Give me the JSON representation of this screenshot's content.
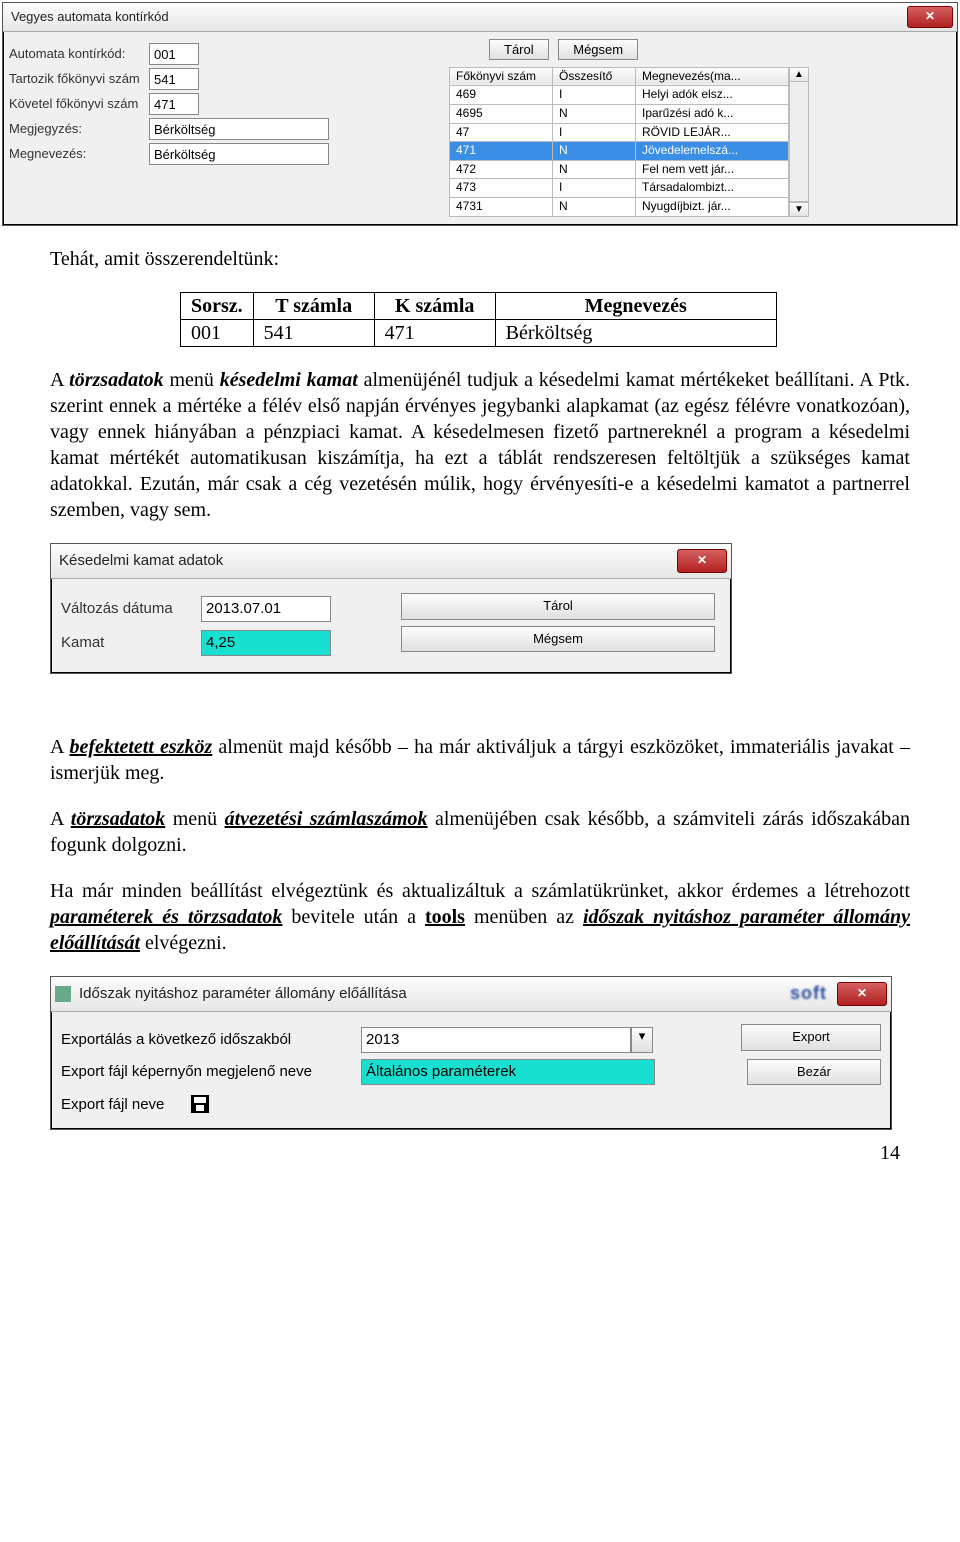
{
  "dialog1": {
    "title": "Vegyes automata kontírkód",
    "row1_label": "Automata kontírkód:",
    "row1_value": "001",
    "row2_label": "Tartozik főkönyvi szám",
    "row2_value": "541",
    "row3_label": "Követel főkönyvi szám",
    "row3_value": "471",
    "row4_label": "Megjegyzés:",
    "row4_value": "Bérköltség",
    "row5_label": "Megnevezés:",
    "row5_value": "Bérköltség",
    "btn_store": "Tárol",
    "btn_cancel": "Mégsem",
    "th1": "Főkönyvi szám",
    "th2": "Összesítő",
    "th3": "Megnevezés(ma...",
    "rows": [
      {
        "a": "469",
        "b": "I",
        "c": "Helyi adók elsz..."
      },
      {
        "a": "4695",
        "b": "N",
        "c": "Iparűzési adó k..."
      },
      {
        "a": "47",
        "b": "I",
        "c": "RÖVID LEJÁR..."
      },
      {
        "a": "471",
        "b": "N",
        "c": "Jövedelemelszá..."
      },
      {
        "a": "472",
        "b": "N",
        "c": "Fel nem vett jár..."
      },
      {
        "a": "473",
        "b": "I",
        "c": "Társadalombizt..."
      },
      {
        "a": "4731",
        "b": "N",
        "c": "Nyugdíjbizt. jár..."
      }
    ]
  },
  "text1": "Tehát, amit összerendeltünk:",
  "doc_table": {
    "h1": "Sorsz.",
    "h2": "T számla",
    "h3": "K számla",
    "h4": "Megnevezés",
    "r1c1": "001",
    "r1c2": "541",
    "r1c3": "471",
    "r1c4": "Bérköltség"
  },
  "para1_a": "A ",
  "para1_b": "törzsadatok",
  "para1_c": " menü ",
  "para1_d": "késedelmi kamat",
  "para1_e": " almenüjénél tudjuk a késedelmi kamat mértékeket beállítani. A Ptk. szerint ennek a mértéke a félév első napján érvényes jegybanki alapkamat (az egész félévre vonatkozóan), vagy ennek hiányában a pénzpiaci kamat. A késedelmesen fizető partnereknél a program a késedelmi kamat mértékét automatikusan kiszámítja, ha ezt a táblát rendszeresen feltöltjük a szükséges kamat adatokkal. Ezután, már csak a cég vezetésén múlik, hogy érvényesíti-e a késedelmi kamatot a partnerrel szemben, vagy sem.",
  "dialog2": {
    "title": "Késedelmi kamat adatok",
    "lbl1": "Változás dátuma",
    "val1": "2013.07.01",
    "lbl2": "Kamat",
    "val2": "4,25",
    "btn_store": "Tárol",
    "btn_cancel": "Mégsem"
  },
  "para2_a": "A ",
  "para2_b": "befektetett eszköz",
  "para2_c": " almenüt majd később – ha már aktiváljuk a tárgyi eszközöket, immateriális javakat – ismerjük meg.",
  "para3_a": "A ",
  "para3_b": "törzsadatok",
  "para3_c": " menü ",
  "para3_d": "átvezetési számlaszámok",
  "para3_e": " almenüjében csak később, a számviteli zárás időszakában fogunk dolgozni.",
  "para4_a": "Ha már minden beállítást elvégeztünk és aktualizáltuk a számlatükrünket, akkor érdemes a létrehozott ",
  "para4_b": "paraméterek és törzsadatok",
  "para4_c": " bevitele után a ",
  "para4_d": "tools",
  "para4_e": " menüben az ",
  "para4_f": "időszak nyitáshoz paraméter állomány előállítását",
  "para4_g": " elvégezni.",
  "dialog3": {
    "title": "Időszak nyitáshoz paraméter állomány előállítása",
    "lbl1": "Exportálás a következő időszakból",
    "val1": "2013",
    "lbl2": "Export fájl képernyőn megjelenő neve",
    "val2": "Általános paraméterek",
    "lbl3": "Export fájl neve",
    "btn_export": "Export",
    "btn_close": "Bezár",
    "brand": "soft"
  },
  "pagenum": "14"
}
